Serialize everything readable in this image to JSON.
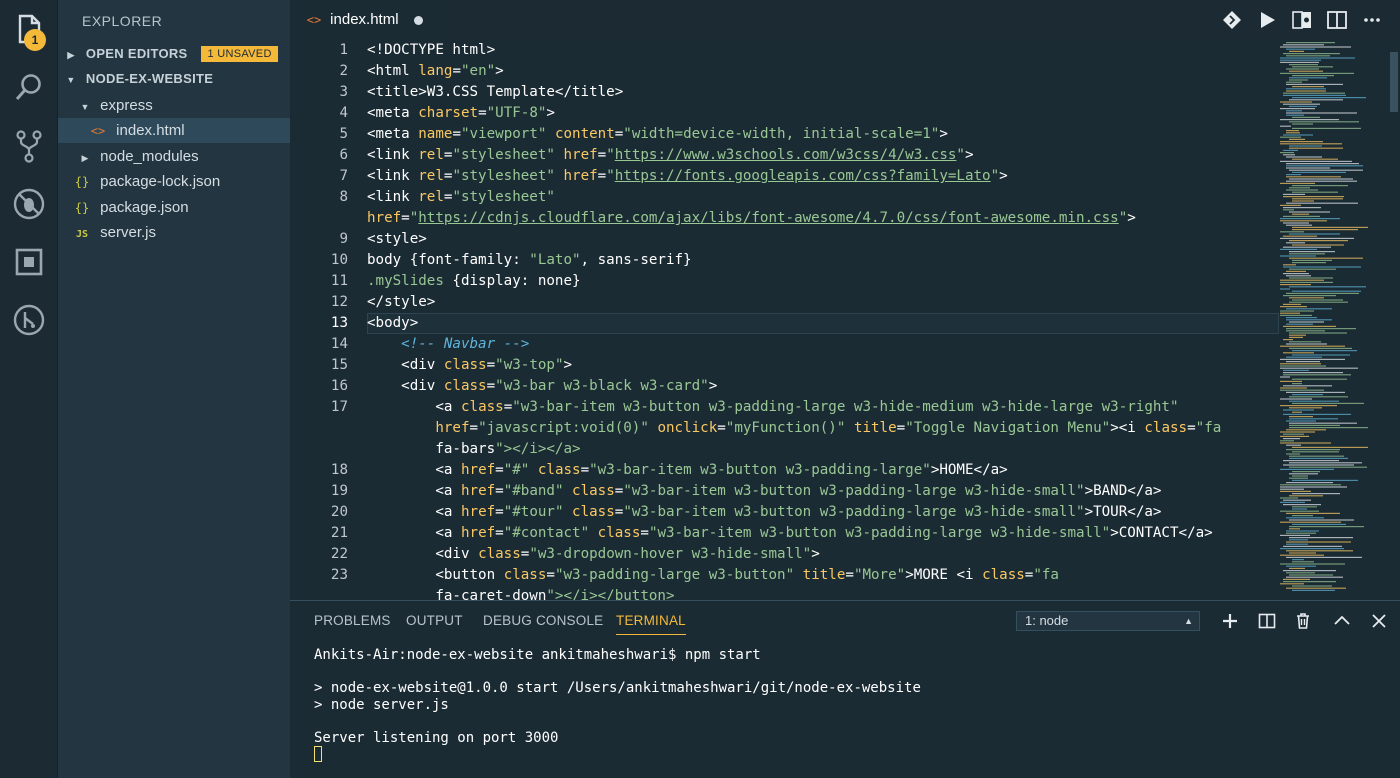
{
  "activity_bar": {
    "explorer_badge": "1",
    "icons": [
      "files-icon",
      "search-icon",
      "source-control-icon",
      "debug-icon",
      "extensions-icon",
      "git-lens-icon"
    ]
  },
  "sidebar": {
    "title": "EXPLORER",
    "open_editors_label": "OPEN EDITORS",
    "unsaved_badge": "1 UNSAVED",
    "project_label": "NODE-EX-WEBSITE",
    "tree": [
      {
        "label": "express",
        "type": "folder-open"
      },
      {
        "label": "index.html",
        "type": "html"
      },
      {
        "label": "node_modules",
        "type": "folder-closed"
      },
      {
        "label": "package-lock.json",
        "type": "json"
      },
      {
        "label": "package.json",
        "type": "json"
      },
      {
        "label": "server.js",
        "type": "js"
      }
    ]
  },
  "editor": {
    "tab_label": "index.html",
    "lines": [
      {
        "n": "1",
        "code": "<!DOCTYPE html>"
      },
      {
        "n": "2",
        "code": "<html lang=\"en\">"
      },
      {
        "n": "3",
        "code": "<title>W3.CSS Template</title>"
      },
      {
        "n": "4",
        "code": "<meta charset=\"UTF-8\">"
      },
      {
        "n": "5",
        "code": "<meta name=\"viewport\" content=\"width=device-width, initial-scale=1\">"
      },
      {
        "n": "6",
        "code": "<link rel=\"stylesheet\" href=\"https://www.w3schools.com/w3css/4/w3.css\">"
      },
      {
        "n": "7",
        "code": "<link rel=\"stylesheet\" href=\"https://fonts.googleapis.com/css?family=Lato\">"
      },
      {
        "n": "8",
        "code": "<link rel=\"stylesheet\""
      },
      {
        "n": "",
        "code": "href=\"https://cdnjs.cloudflare.com/ajax/libs/font-awesome/4.7.0/css/font-awesome.min.css\">"
      },
      {
        "n": "9",
        "code": "<style>"
      },
      {
        "n": "10",
        "code": "body {font-family: \"Lato\", sans-serif}"
      },
      {
        "n": "11",
        "code": ".mySlides {display: none}"
      },
      {
        "n": "12",
        "code": "</style>"
      },
      {
        "n": "13",
        "code": "<body>"
      },
      {
        "n": "14",
        "code": "    <!-- Navbar -->"
      },
      {
        "n": "15",
        "code": "    <div class=\"w3-top\">"
      },
      {
        "n": "16",
        "code": "    <div class=\"w3-bar w3-black w3-card\">"
      },
      {
        "n": "17",
        "code": "        <a class=\"w3-bar-item w3-button w3-padding-large w3-hide-medium w3-hide-large w3-right\""
      },
      {
        "n": "",
        "code": "        href=\"javascript:void(0)\" onclick=\"myFunction()\" title=\"Toggle Navigation Menu\"><i class=\"fa"
      },
      {
        "n": "",
        "code": "        fa-bars\"></i></a>"
      },
      {
        "n": "18",
        "code": "        <a href=\"#\" class=\"w3-bar-item w3-button w3-padding-large\">HOME</a>"
      },
      {
        "n": "19",
        "code": "        <a href=\"#band\" class=\"w3-bar-item w3-button w3-padding-large w3-hide-small\">BAND</a>"
      },
      {
        "n": "20",
        "code": "        <a href=\"#tour\" class=\"w3-bar-item w3-button w3-padding-large w3-hide-small\">TOUR</a>"
      },
      {
        "n": "21",
        "code": "        <a href=\"#contact\" class=\"w3-bar-item w3-button w3-padding-large w3-hide-small\">CONTACT</a>"
      },
      {
        "n": "22",
        "code": "        <div class=\"w3-dropdown-hover w3-hide-small\">"
      },
      {
        "n": "23",
        "code": "        <button class=\"w3-padding-large w3-button\" title=\"More\">MORE <i class=\"fa"
      },
      {
        "n": "",
        "code": "        fa-caret-down\"></i></button>"
      }
    ]
  },
  "panel": {
    "tabs": [
      "PROBLEMS",
      "OUTPUT",
      "DEBUG CONSOLE",
      "TERMINAL"
    ],
    "active_tab": "TERMINAL",
    "terminal_select": "1: node",
    "terminal_lines": [
      "Ankits-Air:node-ex-website ankitmaheshwari$ npm start",
      "",
      "> node-ex-website@1.0.0 start /Users/ankitmaheshwari/git/node-ex-website",
      "> node server.js",
      "",
      "Server listening on port 3000"
    ]
  },
  "colors": {
    "background": "#1b2b34",
    "sidebar": "#223540",
    "accent": "#f5b93a",
    "tag": "#ffffff",
    "attribute": "#fac863",
    "string": "#99c794",
    "comment": "#5fb3d9"
  }
}
